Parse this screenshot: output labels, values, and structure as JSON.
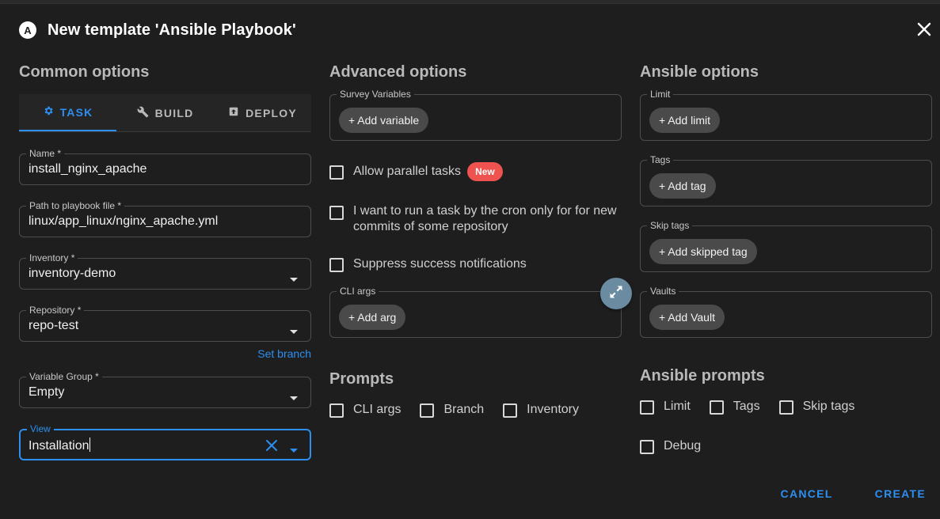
{
  "dialog": {
    "logo_letter": "A",
    "title": "New template 'Ansible Playbook'"
  },
  "common": {
    "heading": "Common options",
    "tabs": [
      {
        "label": "TASK",
        "icon": "gear-icon",
        "active": true
      },
      {
        "label": "BUILD",
        "icon": "wrench-icon",
        "active": false
      },
      {
        "label": "DEPLOY",
        "icon": "upload-box-icon",
        "active": false
      }
    ],
    "fields": {
      "name": {
        "label": "Name *",
        "value": "install_nginx_apache"
      },
      "playbook": {
        "label": "Path to playbook file *",
        "value": "linux/app_linux/nginx_apache.yml"
      },
      "inventory": {
        "label": "Inventory *",
        "value": "inventory-demo"
      },
      "repository": {
        "label": "Repository *",
        "value": "repo-test"
      },
      "variable_group": {
        "label": "Variable Group *",
        "value": "Empty"
      },
      "view": {
        "label": "View",
        "value": "Installation"
      }
    },
    "set_branch": "Set branch"
  },
  "advanced": {
    "heading": "Advanced options",
    "survey": {
      "label": "Survey Variables",
      "chip": "+ Add variable"
    },
    "allow_parallel": {
      "label": "Allow parallel tasks",
      "badge": "New"
    },
    "cron_commits": {
      "label": "I want to run a task by the cron only for for new commits of some repository"
    },
    "suppress": {
      "label": "Suppress success notifications"
    },
    "cli_args": {
      "label": "CLI args",
      "chip": "+ Add arg"
    },
    "prompts_heading": "Prompts",
    "prompts": [
      "CLI args",
      "Branch",
      "Inventory"
    ]
  },
  "ansible": {
    "heading": "Ansible options",
    "limit": {
      "label": "Limit",
      "chip": "+ Add limit"
    },
    "tags": {
      "label": "Tags",
      "chip": "+ Add tag"
    },
    "skip_tags": {
      "label": "Skip tags",
      "chip": "+ Add skipped tag"
    },
    "vaults": {
      "label": "Vaults",
      "chip": "+ Add Vault"
    },
    "prompts_heading": "Ansible prompts",
    "prompts_row1": [
      "Limit",
      "Tags",
      "Skip tags"
    ],
    "prompts_row2": [
      "Debug"
    ]
  },
  "actions": {
    "cancel": "CANCEL",
    "create": "CREATE"
  },
  "colors": {
    "accent": "#2d8ff0",
    "badge": "#ef5350",
    "background": "#1e1e1e"
  }
}
